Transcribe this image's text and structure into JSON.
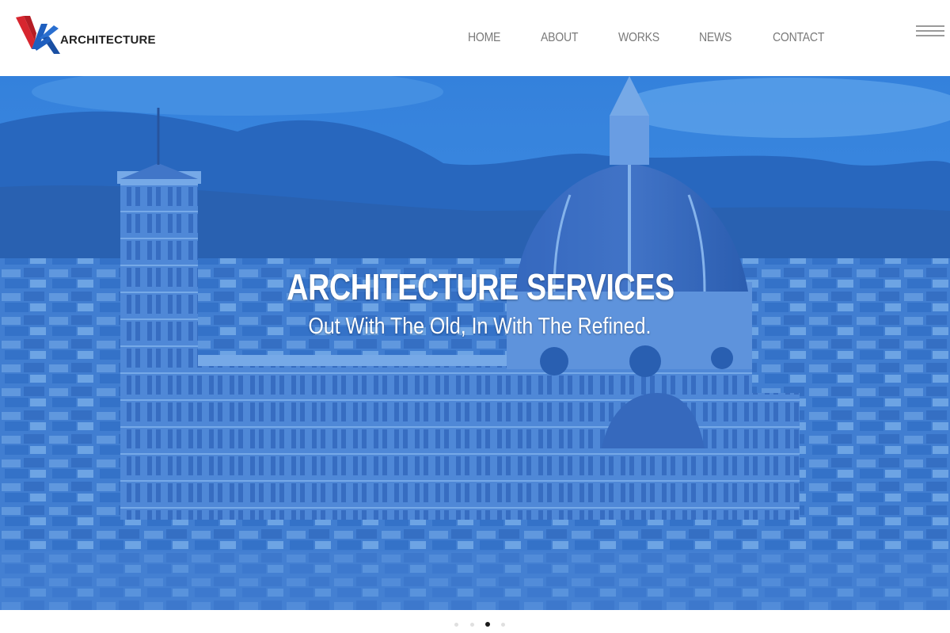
{
  "header": {
    "logo_text": "ARCHITECTURE",
    "nav": [
      {
        "label": "HOME"
      },
      {
        "label": "ABOUT"
      },
      {
        "label": "WORKS"
      },
      {
        "label": "NEWS"
      },
      {
        "label": "CONTACT"
      }
    ]
  },
  "hero": {
    "title": "ARCHITECTURE SERVICES",
    "subtitle": "Out With The Old, In With The Refined.",
    "image_subject": "Florence cathedral dome and city rooftops, blue tinted"
  },
  "slider": {
    "dot_count": 4,
    "active_index": 2
  },
  "colors": {
    "brand_red": "#d7262f",
    "brand_blue": "#1f5fbf",
    "hero_tint": "#3d84d6",
    "nav_text": "#7a7a7a"
  }
}
